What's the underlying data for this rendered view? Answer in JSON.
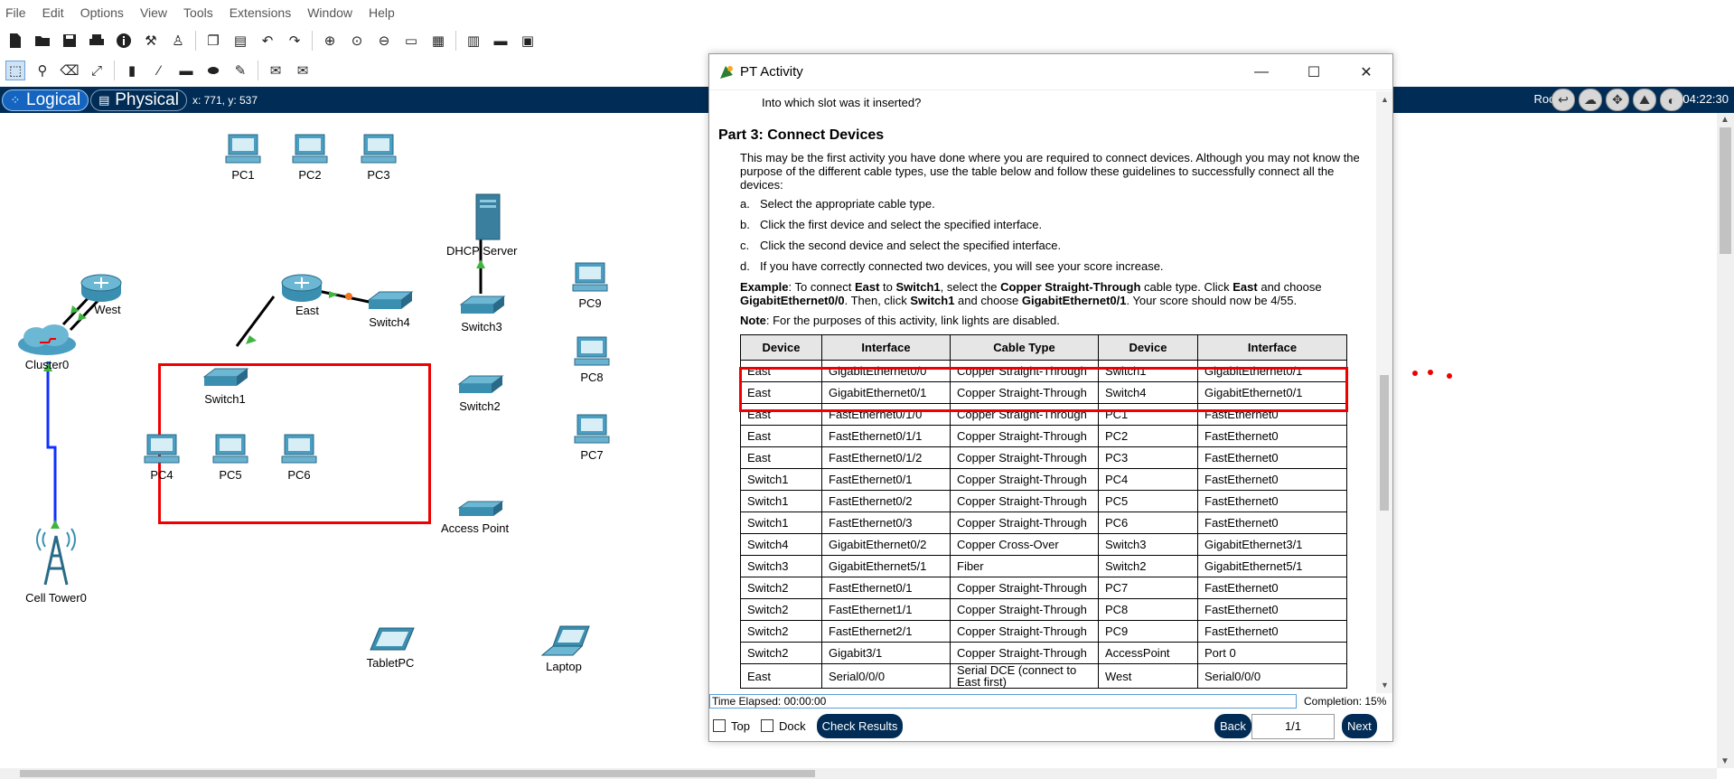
{
  "menu": [
    "File",
    "Edit",
    "Options",
    "View",
    "Tools",
    "Extensions",
    "Window",
    "Help"
  ],
  "toolbar": {
    "icons": [
      "new-file-icon",
      "open-folder-icon",
      "save-icon",
      "print-icon",
      "info-icon",
      "wizard-icon",
      "activity-wizard-icon",
      "copy-icon",
      "paste-icon",
      "undo-icon",
      "redo-icon",
      "zoom-in-icon",
      "zoom-reset-icon",
      "zoom-out-icon",
      "drawing-palette-icon",
      "custom-device-icon",
      "viewport-icon",
      "cluster-icon",
      "image-icon"
    ],
    "help": "?"
  },
  "toolbar2": {
    "icons": [
      "select-icon",
      "inspect-icon",
      "delete-icon",
      "resize-icon",
      "note-icon",
      "line-icon",
      "rectangle-icon",
      "ellipse-icon",
      "freeform-icon",
      "simple-pdu-icon",
      "complex-pdu-icon"
    ]
  },
  "modebar": {
    "logical": "Logical",
    "physical": "Physical",
    "coords": "x: 771, y: 537",
    "root": "Root",
    "clock": "04:22:30"
  },
  "devices": {
    "pc1": "PC1",
    "pc2": "PC2",
    "pc3": "PC3",
    "dhcp": "DHCP Server",
    "west": "West",
    "east": "East",
    "cluster": "Cluster0",
    "switch4": "Switch4",
    "switch3": "Switch3",
    "switch1": "Switch1",
    "switch2": "Switch2",
    "pc9": "PC9",
    "pc8": "PC8",
    "pc7": "PC7",
    "pc4": "PC4",
    "pc5": "PC5",
    "pc6": "PC6",
    "ap": "Access Point",
    "tower": "Cell Tower0",
    "tablet": "TabletPC",
    "laptop": "Laptop"
  },
  "activity": {
    "title": "PT Activity",
    "question": "Into which slot was it inserted?",
    "heading": "Part 3: Connect Devices",
    "intro": "This may be the first activity you have done where you are required to connect devices. Although you may not know the purpose of the different cable types, use the table below and follow these guidelines to successfully connect all the devices:",
    "steps": [
      {
        "letter": "a.",
        "text": "Select the appropriate cable type."
      },
      {
        "letter": "b.",
        "text": "Click the first device and select the specified interface."
      },
      {
        "letter": "c.",
        "text": "Click the second device and select the specified interface."
      },
      {
        "letter": "d.",
        "text": "If you have correctly connected two devices, you will see your score increase."
      }
    ],
    "example": {
      "label": "Example",
      "p1": ": To connect ",
      "b1": "East",
      "p2": " to ",
      "b2": "Switch1",
      "p3": ", select the ",
      "b3": "Copper Straight-Through",
      "p4": " cable type. Click ",
      "b4": "East",
      "p5": " and choose ",
      "b5": "GigabitEthernet0/0",
      "p6": ". Then, click ",
      "b6": "Switch1",
      "p7": " and choose ",
      "b7": "GigabitEthernet0/1",
      "p8": ". Your score should now be 4/55."
    },
    "note": {
      "label": "Note",
      "text": ": For the purposes of this activity, link lights are disabled."
    },
    "table": {
      "headers": [
        "Device",
        "Interface",
        "Cable Type",
        "Device",
        "Interface"
      ],
      "rows": [
        [
          "East",
          "GigabitEthernet0/0",
          "Copper Straight-Through",
          "Switch1",
          "GigabitEthernet0/1"
        ],
        [
          "East",
          "GigabitEthernet0/1",
          "Copper Straight-Through",
          "Switch4",
          "GigabitEthernet0/1"
        ],
        [
          "East",
          "FastEthernet0/1/0",
          "Copper Straight-Through",
          "PC1",
          "FastEthernet0"
        ],
        [
          "East",
          "FastEthernet0/1/1",
          "Copper Straight-Through",
          "PC2",
          "FastEthernet0"
        ],
        [
          "East",
          "FastEthernet0/1/2",
          "Copper Straight-Through",
          "PC3",
          "FastEthernet0"
        ],
        [
          "Switch1",
          "FastEthernet0/1",
          "Copper Straight-Through",
          "PC4",
          "FastEthernet0"
        ],
        [
          "Switch1",
          "FastEthernet0/2",
          "Copper Straight-Through",
          "PC5",
          "FastEthernet0"
        ],
        [
          "Switch1",
          "FastEthernet0/3",
          "Copper Straight-Through",
          "PC6",
          "FastEthernet0"
        ],
        [
          "Switch4",
          "GigabitEthernet0/2",
          "Copper Cross-Over",
          "Switch3",
          "GigabitEthernet3/1"
        ],
        [
          "Switch3",
          "GigabitEthernet5/1",
          "Fiber",
          "Switch2",
          "GigabitEthernet5/1"
        ],
        [
          "Switch2",
          "FastEthernet0/1",
          "Copper Straight-Through",
          "PC7",
          "FastEthernet0"
        ],
        [
          "Switch2",
          "FastEthernet1/1",
          "Copper Straight-Through",
          "PC8",
          "FastEthernet0"
        ],
        [
          "Switch2",
          "FastEthernet2/1",
          "Copper Straight-Through",
          "PC9",
          "FastEthernet0"
        ],
        [
          "Switch2",
          "Gigabit3/1",
          "Copper Straight-Through",
          "AccessPoint",
          "Port 0"
        ],
        [
          "East",
          "Serial0/0/0",
          "Serial DCE (connect to East first)",
          "West",
          "Serial0/0/0"
        ]
      ]
    },
    "time_elapsed": "Time Elapsed: 00:00:00",
    "completion": "Completion: 15%",
    "top_label": "Top",
    "dock_label": "Dock",
    "check_results": "Check Results",
    "back": "Back",
    "page": "1/1",
    "next": "Next"
  },
  "colors": {
    "modebar": "#002c55",
    "highlight": "#e00000",
    "link": "#1030ff",
    "device": "#3a8fb0"
  }
}
